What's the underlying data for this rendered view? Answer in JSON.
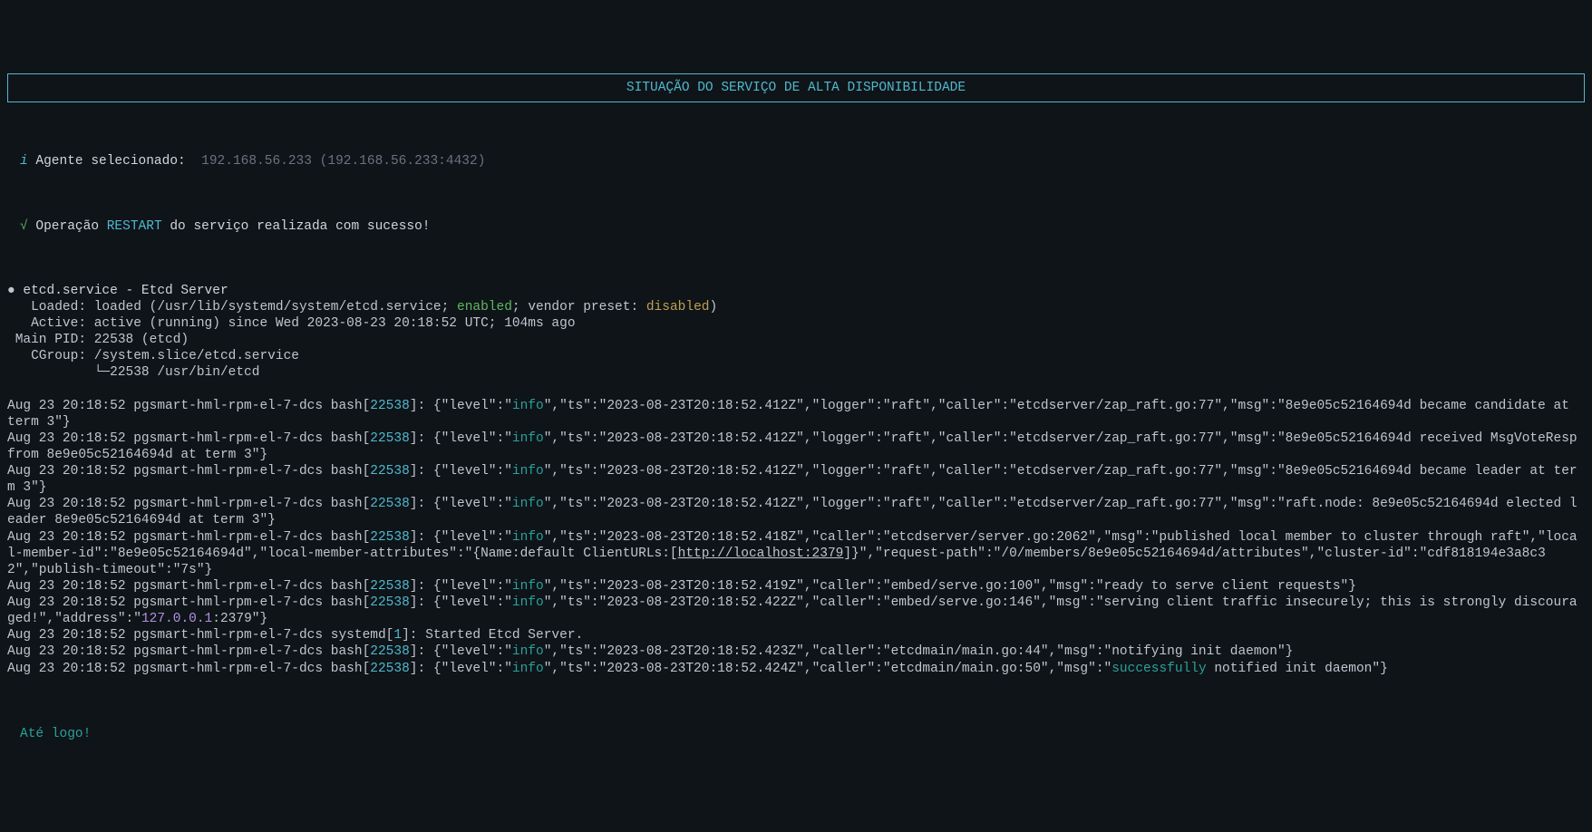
{
  "title": "SITUAÇÃO DO SERVIÇO DE ALTA DISPONIBILIDADE",
  "agent": {
    "icon": "i",
    "label": "Agente selecionado:",
    "value": "192.168.56.233 (192.168.56.233:4432)"
  },
  "operation": {
    "check": "√",
    "prefix": "Operação ",
    "name": "RESTART",
    "suffix": " do serviço realizada com sucesso!"
  },
  "service": {
    "bullet": "●",
    "name": "etcd.service - Etcd Server",
    "loaded_label": "   Loaded: ",
    "loaded_value": "loaded (/usr/lib/systemd/system/etcd.service; ",
    "enabled": "enabled",
    "loaded_mid": "; vendor preset: ",
    "disabled": "disabled",
    "loaded_end": ")",
    "active_label": "   Active: ",
    "active_value": "active (running) since Wed 2023-08-23 20:18:52 UTC; 104ms ago",
    "pid_label": " Main PID: ",
    "pid_value": "22538 (etcd)",
    "cgroup_label": "   CGroup: ",
    "cgroup_value": "/system.slice/etcd.service",
    "cgroup_tree": "           └─22538 /usr/bin/etcd"
  },
  "logs": [
    {
      "prefix": "Aug 23 20:18:52 pgsmart-hml-rpm-el-7-dcs bash[",
      "pid": "22538",
      "mid1": "]: {\"level\":\"",
      "level": "info",
      "rest": "\",\"ts\":\"2023-08-23T20:18:52.412Z\",\"logger\":\"raft\",\"caller\":\"etcdserver/zap_raft.go:77\",\"msg\":\"8e9e05c52164694d became candidate at term 3\"}"
    },
    {
      "prefix": "Aug 23 20:18:52 pgsmart-hml-rpm-el-7-dcs bash[",
      "pid": "22538",
      "mid1": "]: {\"level\":\"",
      "level": "info",
      "rest": "\",\"ts\":\"2023-08-23T20:18:52.412Z\",\"logger\":\"raft\",\"caller\":\"etcdserver/zap_raft.go:77\",\"msg\":\"8e9e05c52164694d received MsgVoteResp from 8e9e05c52164694d at term 3\"}"
    },
    {
      "prefix": "Aug 23 20:18:52 pgsmart-hml-rpm-el-7-dcs bash[",
      "pid": "22538",
      "mid1": "]: {\"level\":\"",
      "level": "info",
      "rest": "\",\"ts\":\"2023-08-23T20:18:52.412Z\",\"logger\":\"raft\",\"caller\":\"etcdserver/zap_raft.go:77\",\"msg\":\"8e9e05c52164694d became leader at term 3\"}"
    },
    {
      "prefix": "Aug 23 20:18:52 pgsmart-hml-rpm-el-7-dcs bash[",
      "pid": "22538",
      "mid1": "]: {\"level\":\"",
      "level": "info",
      "rest": "\",\"ts\":\"2023-08-23T20:18:52.412Z\",\"logger\":\"raft\",\"caller\":\"etcdserver/zap_raft.go:77\",\"msg\":\"raft.node: 8e9e05c52164694d elected leader 8e9e05c52164694d at term 3\"}"
    },
    {
      "prefix": "Aug 23 20:18:52 pgsmart-hml-rpm-el-7-dcs bash[",
      "pid": "22538",
      "mid1": "]: {\"level\":\"",
      "level": "info",
      "rest_a": "\",\"ts\":\"2023-08-23T20:18:52.418Z\",\"caller\":\"etcdserver/server.go:2062\",\"msg\":\"published local member to cluster through raft\",\"local-member-id\":\"8e9e05c52164694d\",\"local-member-attributes\":\"{Name:default ClientURLs:[",
      "url": "http://localhost:2379",
      "rest_b": "]}\",\"request-path\":\"/0/members/8e9e05c52164694d/attributes\",\"cluster-id\":\"cdf818194e3a8c32\",\"publish-timeout\":\"7s\"}"
    },
    {
      "prefix": "Aug 23 20:18:52 pgsmart-hml-rpm-el-7-dcs bash[",
      "pid": "22538",
      "mid1": "]: {\"level\":\"",
      "level": "info",
      "rest": "\",\"ts\":\"2023-08-23T20:18:52.419Z\",\"caller\":\"embed/serve.go:100\",\"msg\":\"ready to serve client requests\"}"
    },
    {
      "prefix": "Aug 23 20:18:52 pgsmart-hml-rpm-el-7-dcs bash[",
      "pid": "22538",
      "mid1": "]: {\"level\":\"",
      "level": "info",
      "rest_a": "\",\"ts\":\"2023-08-23T20:18:52.422Z\",\"caller\":\"embed/serve.go:146\",\"msg\":\"serving client traffic insecurely; this is strongly discouraged!\",\"address\":\"",
      "addr": "127.0.0.1",
      "rest_b": ":2379\"}"
    },
    {
      "prefix": "Aug 23 20:18:52 pgsmart-hml-rpm-el-7-dcs systemd[",
      "pid": "1",
      "mid1": "]: ",
      "plain": "Started Etcd Server."
    },
    {
      "prefix": "Aug 23 20:18:52 pgsmart-hml-rpm-el-7-dcs bash[",
      "pid": "22538",
      "mid1": "]: {\"level\":\"",
      "level": "info",
      "rest": "\",\"ts\":\"2023-08-23T20:18:52.423Z\",\"caller\":\"etcdmain/main.go:44\",\"msg\":\"notifying init daemon\"}"
    },
    {
      "prefix": "Aug 23 20:18:52 pgsmart-hml-rpm-el-7-dcs bash[",
      "pid": "22538",
      "mid1": "]: {\"level\":\"",
      "level": "info",
      "rest_a": "\",\"ts\":\"2023-08-23T20:18:52.424Z\",\"caller\":\"etcdmain/main.go:50\",\"msg\":\"",
      "success": "successfully",
      "rest_b": " notified init daemon\"}"
    }
  ],
  "farewell": "Até logo!"
}
